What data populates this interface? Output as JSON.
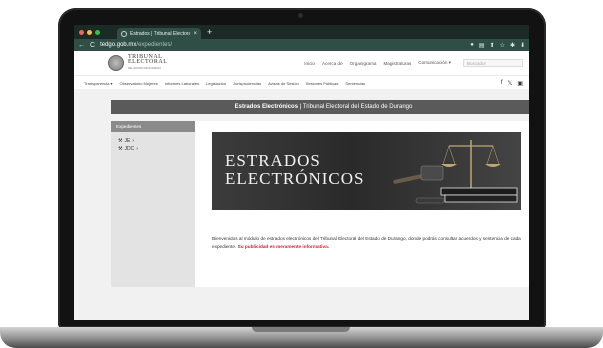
{
  "browser": {
    "tab_title": "Estrados | Tribunal Electoral",
    "tab_close": "×",
    "new_tab": "+",
    "url_host": "tedgo.gob.mx",
    "url_path": "/expedientes/",
    "back": "←",
    "reload": "C",
    "lock": "🔒"
  },
  "site": {
    "logo_line1": "TRIBUNAL",
    "logo_line2": "ELECTORAL",
    "logo_line3": "DEL ESTADO DE DURANGO",
    "main_nav": [
      "Inicio",
      "Acerca de",
      "Organigrama",
      "Magistraturas",
      "Comunicación ▾"
    ],
    "search_placeholder": "Buscador",
    "sub_nav": [
      "Transparencia ▾",
      "Observatorio Mujeres",
      "Informes Laborales",
      "Legislación",
      "Jurisprudencias",
      "Avisos de Sesión",
      "Sesiones Públicas",
      "Sentencias"
    ],
    "social": [
      "f",
      "𝕏",
      "▣"
    ]
  },
  "page": {
    "title_bold": "Estrados Electrónicos",
    "title_rest": " | Tribunal Electoral del Estado de Durango",
    "sidebar_header": "Expedientes",
    "sidebar_items": [
      "JE",
      "JDC"
    ],
    "hero_line1": "ESTRADOS",
    "hero_line2": "ELECTRÓNICOS",
    "description": "Bienvenidos al módulo de estrados electrónicos del Tribunal Electoral del Estado de Durango, donde podrás consultar acuerdos y sentencia de cada expediente.",
    "description_highlight": "Su publicidad es meramente informativa."
  }
}
